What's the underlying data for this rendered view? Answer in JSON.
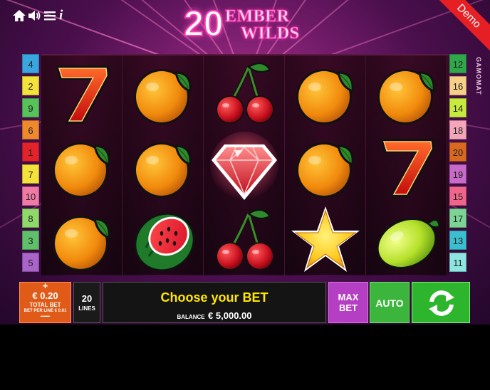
{
  "colors": {
    "accent": "#ff3cb4",
    "demo": "#e51f24",
    "bet_box": "#e05a18",
    "message": "#ffe600",
    "maxbet": "#b53fc2",
    "auto": "#3bb53b",
    "spin": "#2db52d"
  },
  "top_bar": {
    "icons": [
      "home-icon",
      "speaker-icon",
      "menu-icon",
      "info-icon"
    ],
    "info_glyph": "i"
  },
  "logo": {
    "number": "20",
    "word1": "EMBER",
    "word2": "WILDS"
  },
  "demo_label": "Demo",
  "provider": "GAMOMAT",
  "reels": [
    [
      "seven",
      "orange",
      "orange"
    ],
    [
      "orange",
      "orange",
      "watermelon"
    ],
    [
      "cherry",
      "diamond",
      "cherry"
    ],
    [
      "orange",
      "orange",
      "star"
    ],
    [
      "orange",
      "seven",
      "lime"
    ]
  ],
  "left_lines": [
    {
      "num": "4",
      "color": "#3aa6e0"
    },
    {
      "num": "2",
      "color": "#f2e23a"
    },
    {
      "num": "9",
      "color": "#58c25a"
    },
    {
      "num": "6",
      "color": "#ef8a2c"
    },
    {
      "num": "1",
      "color": "#e2232a"
    },
    {
      "num": "7",
      "color": "#f2e23a"
    },
    {
      "num": "10",
      "color": "#f07aa6"
    },
    {
      "num": "8",
      "color": "#8fd86a"
    },
    {
      "num": "3",
      "color": "#5fbf6a"
    },
    {
      "num": "5",
      "color": "#a864c8"
    }
  ],
  "right_lines": [
    {
      "num": "12",
      "color": "#2fa84a"
    },
    {
      "num": "16",
      "color": "#f6cf88"
    },
    {
      "num": "14",
      "color": "#c7ea3e"
    },
    {
      "num": "18",
      "color": "#f4a6b8"
    },
    {
      "num": "20",
      "color": "#d9691e"
    },
    {
      "num": "19",
      "color": "#c76ac8"
    },
    {
      "num": "15",
      "color": "#f0668a"
    },
    {
      "num": "17",
      "color": "#7bd494"
    },
    {
      "num": "13",
      "color": "#3bbfd0"
    },
    {
      "num": "11",
      "color": "#8de7e0"
    }
  ],
  "controls": {
    "plus": "+",
    "bet_amount": "€ 0.20",
    "total_bet_label": "TOTAL BET",
    "bet_per_line": "BET PER LINE € 0.01",
    "minus": "—",
    "lines_value": "20",
    "lines_label": "LINES",
    "message": "Choose your BET",
    "balance_label": "BALANCE",
    "balance_value": "€ 5,000.00",
    "maxbet_line1": "MAX",
    "maxbet_line2": "BET",
    "auto_label": "AUTO"
  }
}
